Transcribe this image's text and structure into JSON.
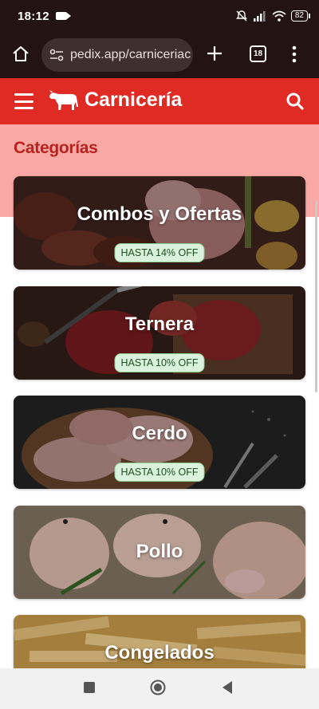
{
  "status": {
    "time": "18:12",
    "battery": "82"
  },
  "browser": {
    "url": "pedix.app/carniceriac",
    "tab_count": "18"
  },
  "header": {
    "brand": "Carnicería"
  },
  "categories_title": "Categorías",
  "cards": [
    {
      "name": "Combos y Ofertas",
      "badge": "HASTA 14% OFF"
    },
    {
      "name": "Ternera",
      "badge": "HASTA 10% OFF"
    },
    {
      "name": "Cerdo",
      "badge": "HASTA 10% OFF"
    },
    {
      "name": "Pollo"
    },
    {
      "name": "Congelados"
    }
  ],
  "colors": {
    "header_red": "#e02a24",
    "band_pink": "#f9a8a6",
    "title_red": "#b7221d",
    "badge_green": "#daf1dc"
  }
}
